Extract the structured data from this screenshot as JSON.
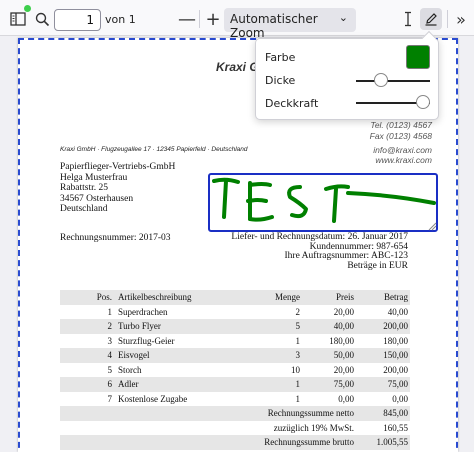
{
  "toolbar": {
    "page_number": "1",
    "page_of": "von 1",
    "zoom_label": "Automatischer Zoom"
  },
  "document": {
    "company_title": "Kraxi G",
    "contact": {
      "tel": "Tel. (0123) 4567",
      "fax": "Fax (0123) 4568",
      "email": "info@kraxi.com",
      "web": "www.kraxi.com"
    },
    "sender_line": "Kraxi GmbH · Flugzeugallee 17 · 12345 Papierfeld · Deutschland",
    "recipient": [
      "Papierflieger-Vertriebs-GmbH",
      "Helga Musterfrau",
      "Rabattstr. 25",
      "34567 Osterhausen",
      "Deutschland"
    ],
    "invoice_number": "Rechnungsnummer: 2017-03",
    "meta": [
      "Liefer- und Rechnungsdatum: 26. Januar 2017",
      "Kundennummer: 987-654",
      "Ihre Auftragsnummer: ABC-123",
      "Beträge in EUR"
    ],
    "annotation_text": "TEST",
    "table": {
      "headers": [
        "Pos.",
        "Artikelbeschreibung",
        "Menge",
        "Preis",
        "Betrag"
      ],
      "rows": [
        [
          "1",
          "Superdrachen",
          "2",
          "20,00",
          "40,00"
        ],
        [
          "2",
          "Turbo Flyer",
          "5",
          "40,00",
          "200,00"
        ],
        [
          "3",
          "Sturzflug-Geier",
          "1",
          "180,00",
          "180,00"
        ],
        [
          "4",
          "Eisvogel",
          "3",
          "50,00",
          "150,00"
        ],
        [
          "5",
          "Storch",
          "10",
          "20,00",
          "200,00"
        ],
        [
          "6",
          "Adler",
          "1",
          "75,00",
          "75,00"
        ],
        [
          "7",
          "Kostenlose Zugabe",
          "1",
          "0,00",
          "0,00"
        ]
      ],
      "totals": [
        {
          "label": "Rechnungssumme netto",
          "value": "845,00"
        },
        {
          "label": "zuzüglich 19% MwSt.",
          "value": "160,55"
        },
        {
          "label": "Rechnungssumme brutto",
          "value": "1.005,55"
        }
      ]
    }
  },
  "popover": {
    "color_label": "Farbe",
    "thickness_label": "Dicke",
    "opacity_label": "Deckkraft",
    "color_value": "#008000",
    "thickness_fraction": 0.3,
    "opacity_fraction": 1.0
  },
  "icons": {
    "sidebar": "sidebar-toggle-icon",
    "search": "search-icon",
    "zoom_out": "minus-icon",
    "zoom_in": "plus-icon",
    "dropdown": "chevron-down-icon",
    "text": "text-cursor-icon",
    "draw": "pencil-icon",
    "more": "double-chevron-right-icon"
  },
  "colors": {
    "ink": "#008000",
    "selection_border": "#1a2fc4",
    "page_border": "#2a4bd0"
  }
}
